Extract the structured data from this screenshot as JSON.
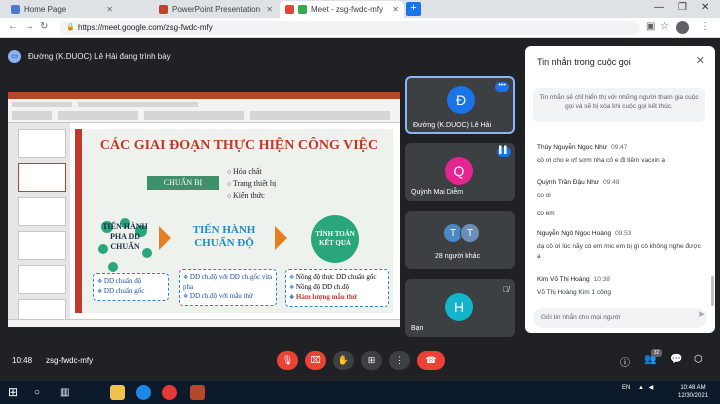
{
  "browser": {
    "tabs": [
      {
        "label": "Home Page",
        "icon": "home-page-favicon"
      },
      {
        "label": "PowerPoint Presentation",
        "icon": "powerpoint-favicon"
      },
      {
        "label": "Meet - zsg-fwdc-mfy",
        "icon": "meet-favicon"
      }
    ],
    "new_tab": "+",
    "url": "https://meet.google.com/zsg-fwdc-mfy"
  },
  "meet": {
    "presenter_text": "Đường (K.DUOC) Lê Hải đang trình bày",
    "slide": {
      "title": "CÁC GIAI ĐOẠN THỰC HIỆN CÔNG VIỆC",
      "prepare_label": "CHUẨN BỊ",
      "prepare_items": [
        "Hóa chất",
        "Trang thiết bị",
        "Kiến thức"
      ],
      "step1": "TIẾN HÀNH PHA DD CHUẨN",
      "step2": "TIẾN HÀNH CHUẨN ĐỘ",
      "step3": "TÍNH TOÁN KẾT QUẢ",
      "box1": [
        "DD chuẩn độ",
        "DD chuẩn gốc"
      ],
      "box2": [
        "DD ch.độ với DD ch.gốc vừa pha",
        "DD ch.độ với mẫu thử"
      ],
      "box3": [
        "Nồng độ thực DD chuẩn gốc",
        "Nồng độ DD ch.độ",
        "Hàm lượng mẫu thử"
      ]
    },
    "tiles": [
      {
        "name": "Đường (K.DUOC) Lê Hải",
        "initial": "Đ",
        "color": "#1a73e8"
      },
      {
        "name": "Quỳnh Mai Diễm",
        "initial": "Q",
        "color": "#e52592"
      },
      {
        "name": "28 người khác",
        "initials": [
          "T",
          "T"
        ]
      },
      {
        "name": "Bạn",
        "initial": "H",
        "color": "#12b5cb"
      }
    ],
    "time": "10:48",
    "code": "zsg-fwdc-mfy",
    "people_count": "32"
  },
  "chat": {
    "title": "Tin nhắn trong cuộc gọi",
    "note": "Tin nhắn sẽ chỉ hiển thị với những người tham gia cuộc gọi và sẽ bị xóa khi cuộc gọi kết thúc.",
    "messages": [
      {
        "sender": "Thúy Nguyễn Ngọc Như",
        "time": "09:47",
        "text": "cô ơi cho e ơf sơm nha cô e đi tiêm vacxin ạ"
      },
      {
        "sender": "Quỳnh Trần Đậu Như",
        "time": "09:48",
        "text": "co oi",
        "text2": "co em"
      },
      {
        "sender": "Nguyễn Ngô Ngọc Hoàng",
        "time": "09:53",
        "text": "dạ cô ơi lúc nãy có em mic em bị gì cô không nghe được ạ"
      },
      {
        "sender": "Kim Võ Thị Hoàng",
        "time": "10:38",
        "text": "Võ Thị Hoàng Kim 1 công"
      }
    ],
    "input_placeholder": "Gửi tin nhắn cho mọi người"
  },
  "taskbar": {
    "lang": "EN",
    "time": "10:48 AM",
    "date": "12/30/2021"
  }
}
